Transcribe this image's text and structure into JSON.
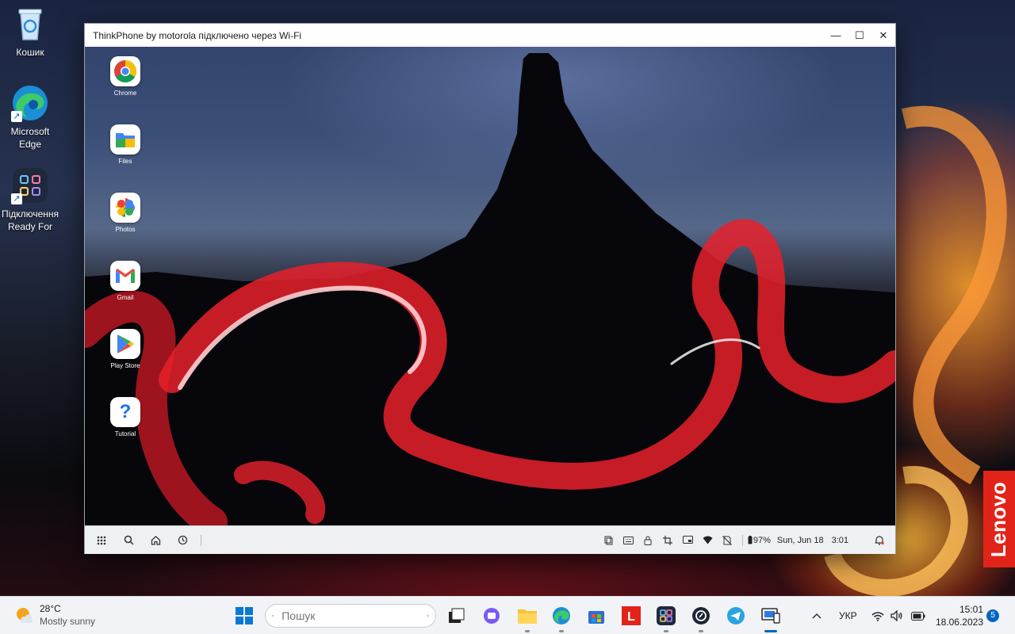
{
  "desktop": {
    "icons": [
      {
        "label": "Кошик",
        "icon": "recycle-bin-icon"
      },
      {
        "label": "Microsoft Edge",
        "icon": "edge-icon"
      },
      {
        "label": "Підключення Ready For",
        "icon": "ready-for-icon"
      }
    ],
    "brand_logo_text": "Lenovo"
  },
  "phone_window": {
    "title": "ThinkPhone by motorola підключено через Wi-Fi",
    "controls": {
      "minimize": "—",
      "maximize": "☐",
      "close": "✕"
    },
    "apps": [
      {
        "label": "Chrome",
        "icon": "chrome-icon"
      },
      {
        "label": "Files",
        "icon": "files-icon"
      },
      {
        "label": "Photos",
        "icon": "photos-icon"
      },
      {
        "label": "Gmail",
        "icon": "gmail-icon"
      },
      {
        "label": "Play Store",
        "icon": "play-store-icon"
      },
      {
        "label": "Tutorial",
        "icon": "tutorial-icon"
      }
    ],
    "taskbar": {
      "battery": "97%",
      "date": "Sun, Jun 18",
      "time": "3:01"
    }
  },
  "taskbar": {
    "weather": {
      "temp": "28°C",
      "condition": "Mostly sunny"
    },
    "search": {
      "placeholder": "Пошук"
    },
    "language": "УКР",
    "clock": {
      "time": "15:01",
      "date": "18.06.2023"
    },
    "notification_count": "5"
  },
  "colors": {
    "accent": "#0067c0",
    "lenovo_red": "#e2231a"
  }
}
